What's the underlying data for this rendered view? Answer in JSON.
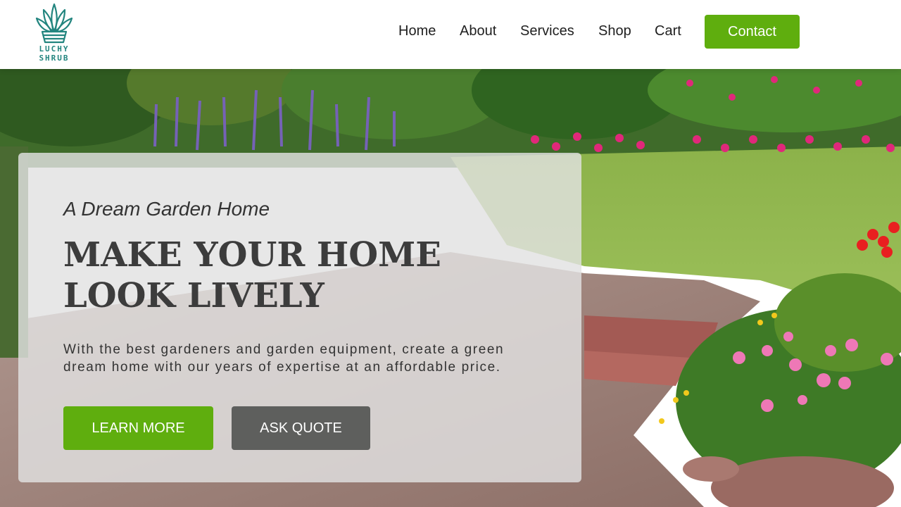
{
  "brand": {
    "logo_text_line1": "LUCHY",
    "logo_text_line2": "SHRUB",
    "accent": "#5fae0e",
    "logo_color": "#23857f"
  },
  "nav": {
    "items": [
      "Home",
      "About",
      "Services",
      "Shop",
      "Cart"
    ],
    "contact_label": "Contact"
  },
  "hero": {
    "subtitle": "A Dream Garden Home",
    "headline_line1": "MAKE YOUR HOME",
    "headline_line2": "LOOK LIVELY",
    "description": "With the best gardeners and garden equipment, create a green dream home with our years of expertise at an affordable price.",
    "learn_more_label": "LEARN MORE",
    "ask_quote_label": "ASK QUOTE",
    "secondary_color": "#5e5f5d"
  }
}
